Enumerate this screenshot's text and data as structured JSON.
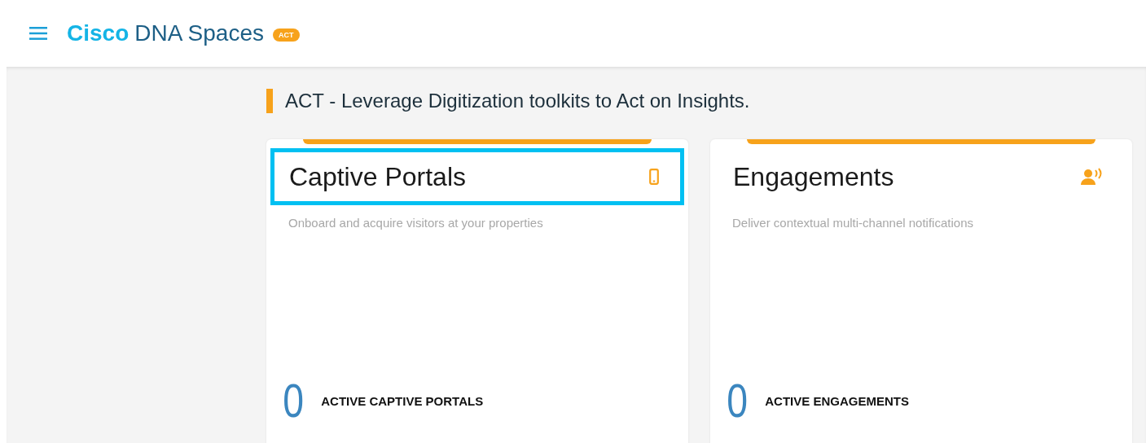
{
  "header": {
    "brand_bold": "Cisco",
    "brand_rest": "DNA Spaces",
    "badge": "ACT"
  },
  "section": {
    "title": "ACT - Leverage Digitization toolkits to Act on Insights."
  },
  "cards": [
    {
      "title": "Captive Portals",
      "highlighted": true,
      "description": "Onboard and acquire visitors at your properties",
      "count": "0",
      "count_label": "ACTIVE CAPTIVE PORTALS"
    },
    {
      "title": "Engagements",
      "highlighted": false,
      "description": "Deliver contextual multi-channel notifications",
      "count": "0",
      "count_label": "ACTIVE ENGAGEMENTS"
    }
  ]
}
